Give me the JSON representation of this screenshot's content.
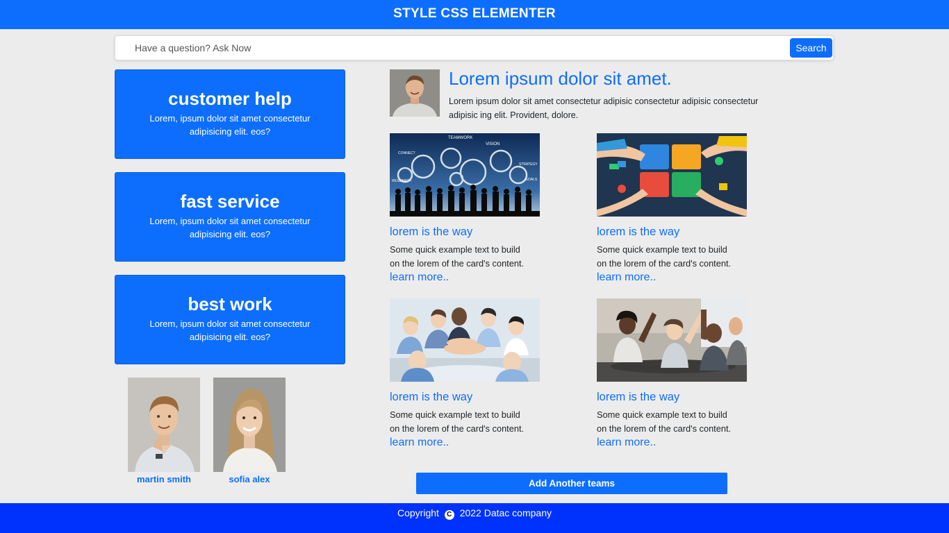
{
  "header": {
    "title": "STYLE CSS ELEMENTER"
  },
  "search": {
    "placeholder": "Have a question? Ask Now",
    "button_label": "Search"
  },
  "features": [
    {
      "title": "customer help",
      "text": "Lorem, ipsum dolor sit amet consectetur adipisicing elit. eos?"
    },
    {
      "title": "fast service",
      "text": "Lorem, ipsum dolor sit amet consectetur adipisicing elit. eos?"
    },
    {
      "title": "best work",
      "text": "Lorem, ipsum dolor sit amet consectetur adipisicing elit. eos?"
    }
  ],
  "people": [
    {
      "name": "martin smith"
    },
    {
      "name": "sofia alex"
    }
  ],
  "hero": {
    "title": "Lorem ipsum dolor sit amet.",
    "text": "Lorem ipsum dolor sit amet consectetur adipisic consectetur adipisic consectetur adipisic ing elit. Provident, dolore."
  },
  "gears_image": {
    "labels": [
      "TEAMWORK",
      "CONNECT",
      "VISION",
      "RESEARCH",
      "STRATEGY",
      "GOALS"
    ]
  },
  "cards": [
    {
      "title": "lorem is the way",
      "text": "Some quick example text to build on the lorem of the card's content.",
      "link": "learn more.."
    },
    {
      "title": "lorem is the way",
      "text": "Some quick example text to build on the lorem of the card's content.",
      "link": "learn more.."
    },
    {
      "title": "lorem is the way",
      "text": "Some quick example text to build on the lorem of the card's content.",
      "link": "learn more.."
    },
    {
      "title": "lorem is the way",
      "text": "Some quick example text to build on the lorem of the card's content.",
      "link": "learn more.."
    }
  ],
  "add_button": {
    "label": "Add Another teams"
  },
  "footer": {
    "prefix": "Copyright",
    "icon": "copyright-icon",
    "symbol": "C",
    "suffix": "2022 Datac company"
  },
  "colors": {
    "primary": "#0d6efd",
    "footer": "#0032fe",
    "background": "#ececec"
  }
}
